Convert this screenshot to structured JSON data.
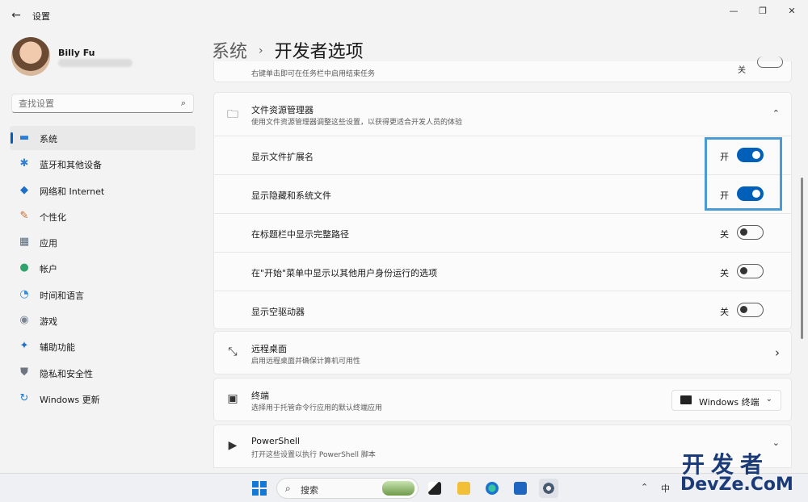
{
  "window": {
    "title": "设置",
    "back_icon": "←",
    "minimize_icon": "—",
    "maximize_icon": "❐",
    "close_icon": "✕"
  },
  "profile": {
    "name": "Billy Fu"
  },
  "search": {
    "placeholder": "查找设置",
    "icon": "⌕"
  },
  "sidebar": {
    "items": [
      {
        "label": "系统",
        "icon": "▬",
        "color": "#2b7bd2",
        "active": true
      },
      {
        "label": "蓝牙和其他设备",
        "icon": "✱",
        "color": "#2c7fd4",
        "active": false
      },
      {
        "label": "网络和 Internet",
        "icon": "◆",
        "color": "#1d6fc8",
        "active": false
      },
      {
        "label": "个性化",
        "icon": "✎",
        "color": "#c86a2a",
        "active": false
      },
      {
        "label": "应用",
        "icon": "▦",
        "color": "#5a6b7c",
        "active": false
      },
      {
        "label": "帐户",
        "icon": "●",
        "color": "#2fa36b",
        "active": false
      },
      {
        "label": "时间和语言",
        "icon": "◔",
        "color": "#3a8bd6",
        "active": false
      },
      {
        "label": "游戏",
        "icon": "◉",
        "color": "#7b8794",
        "active": false
      },
      {
        "label": "辅助功能",
        "icon": "✦",
        "color": "#2270c4",
        "active": false
      },
      {
        "label": "隐私和安全性",
        "icon": "⛊",
        "color": "#6c7580",
        "active": false
      },
      {
        "label": "Windows 更新",
        "icon": "↻",
        "color": "#1f7ad1",
        "active": false
      }
    ]
  },
  "breadcrumb": {
    "parent": "系统",
    "separator": "›",
    "current": "开发者选项"
  },
  "partial_top": {
    "text": "右键单击即可在任务栏中启用结束任务",
    "state": "关"
  },
  "file_explorer": {
    "icon": "🗀",
    "title": "文件资源管理器",
    "desc": "使用文件资源管理器调整这些设置，以获得更适合开发人员的体验",
    "chevron": "⌃",
    "options": [
      {
        "label": "显示文件扩展名",
        "state": "开",
        "on": true
      },
      {
        "label": "显示隐藏和系统文件",
        "state": "开",
        "on": true
      },
      {
        "label": "在标题栏中显示完整路径",
        "state": "关",
        "on": false
      },
      {
        "label": "在\"开始\"菜单中显示以其他用户身份运行的选项",
        "state": "关",
        "on": false
      },
      {
        "label": "显示空驱动器",
        "state": "关",
        "on": false
      }
    ]
  },
  "remote_desktop": {
    "icon": "⤡",
    "title": "远程桌面",
    "desc": "启用远程桌面并确保计算机可用性",
    "chevron": "›"
  },
  "terminal": {
    "icon": "▣",
    "title": "终端",
    "desc": "选择用于托管命令行应用的默认终端应用",
    "dropdown_value": "Windows 终端",
    "dropdown_chevron": "⌄"
  },
  "powershell": {
    "icon": "▶",
    "title": "PowerShell",
    "desc": "打开这些设置以执行 PowerShell 脚本",
    "chevron": "⌄"
  },
  "taskbar": {
    "search_label": "搜索",
    "search_icon": "⌕",
    "tray_chevron": "⌃",
    "ime": "中"
  },
  "watermark": {
    "cn": "开发者",
    "en": "DevZe.CoM"
  }
}
